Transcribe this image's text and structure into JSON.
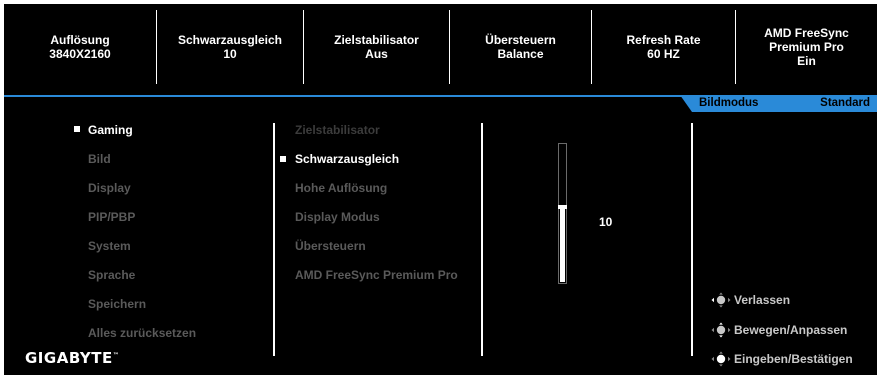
{
  "info_bar": [
    {
      "title": "Auflösung",
      "value": "3840X2160"
    },
    {
      "title": "Schwarzausgleich",
      "value": "10"
    },
    {
      "title": "Zielstabilisator",
      "value": "Aus"
    },
    {
      "title": "Übersteuern",
      "value": "Balance"
    },
    {
      "title": "Refresh Rate",
      "value": "60 HZ"
    },
    {
      "title": "AMD FreeSync\nPremium Pro",
      "value": "Ein"
    }
  ],
  "mode_tab": {
    "label": "Bildmodus",
    "value": "Standard"
  },
  "main_menu": [
    {
      "label": "Gaming",
      "active": true
    },
    {
      "label": "Bild",
      "active": false
    },
    {
      "label": "Display",
      "active": false
    },
    {
      "label": "PIP/PBP",
      "active": false
    },
    {
      "label": "System",
      "active": false
    },
    {
      "label": "Sprache",
      "active": false
    },
    {
      "label": "Speichern",
      "active": false
    },
    {
      "label": "Alles zurücksetzen",
      "active": false
    }
  ],
  "sub_menu": [
    {
      "label": "Zielstabilisator",
      "active": false,
      "dim": true
    },
    {
      "label": "Schwarzausgleich",
      "active": true
    },
    {
      "label": "Hohe Auflösung",
      "active": false
    },
    {
      "label": "Display Modus",
      "active": false
    },
    {
      "label": "Übersteuern",
      "active": false
    },
    {
      "label": "AMD FreeSync Premium Pro",
      "active": false
    }
  ],
  "slider": {
    "value": "10",
    "level": 0.55
  },
  "hints": [
    {
      "icon": "dpad-left-icon",
      "label": "Verlassen"
    },
    {
      "icon": "dpad-up-down-icon",
      "label": "Bewegen/Anpassen"
    },
    {
      "icon": "dpad-press-icon",
      "label": "Eingeben/Bestätigen"
    }
  ],
  "brand": {
    "logo": "GIGABYTE",
    "tm": "™"
  },
  "colors": {
    "accent": "#2a8ad8",
    "background": "#000000",
    "inactive": "#5a5a5a"
  }
}
